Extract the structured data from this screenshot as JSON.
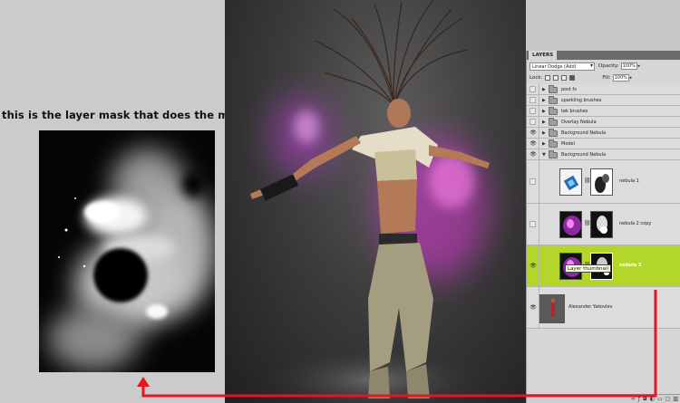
{
  "caption": "this is the layer mask that does the magic",
  "layers_panel": {
    "tab_label": "LAYERS",
    "blend_mode": "Linear Dodge (Add)",
    "opacity_label": "Opacity:",
    "opacity_value": "100%",
    "lock_label": "Lock:",
    "fill_label": "Fill:",
    "fill_value": "100%",
    "layers": [
      {
        "name": "post fx",
        "type": "group",
        "visible": false
      },
      {
        "name": "sparkling brushes",
        "type": "group",
        "visible": false
      },
      {
        "name": "tek brushes",
        "type": "group",
        "visible": false
      },
      {
        "name": "Overlay Nebula",
        "type": "group",
        "visible": false
      },
      {
        "name": "Background Nebula",
        "type": "group",
        "visible": true
      },
      {
        "name": "Model",
        "type": "group",
        "visible": true
      },
      {
        "name": "Background Nebula",
        "type": "group",
        "visible": true,
        "expanded": true
      },
      {
        "name": "nebula 1",
        "type": "layer",
        "visible": false
      },
      {
        "name": "nebula 2 copy",
        "type": "layer",
        "visible": false
      },
      {
        "name": "nebula 2",
        "type": "layer",
        "visible": true,
        "selected": true
      },
      {
        "name": "Alexander Yakovlev",
        "type": "layer",
        "visible": true
      }
    ],
    "tooltip": "Layer thumbnail"
  },
  "colors": {
    "selected_layer": "#b2d62a",
    "connector_arrow": "#e8141e",
    "nebula_glow": "#e040d8"
  },
  "icons": {
    "eye": "eye-icon",
    "folder": "folder-icon",
    "chain": "link-icon",
    "expand": "triangle-right-icon"
  }
}
